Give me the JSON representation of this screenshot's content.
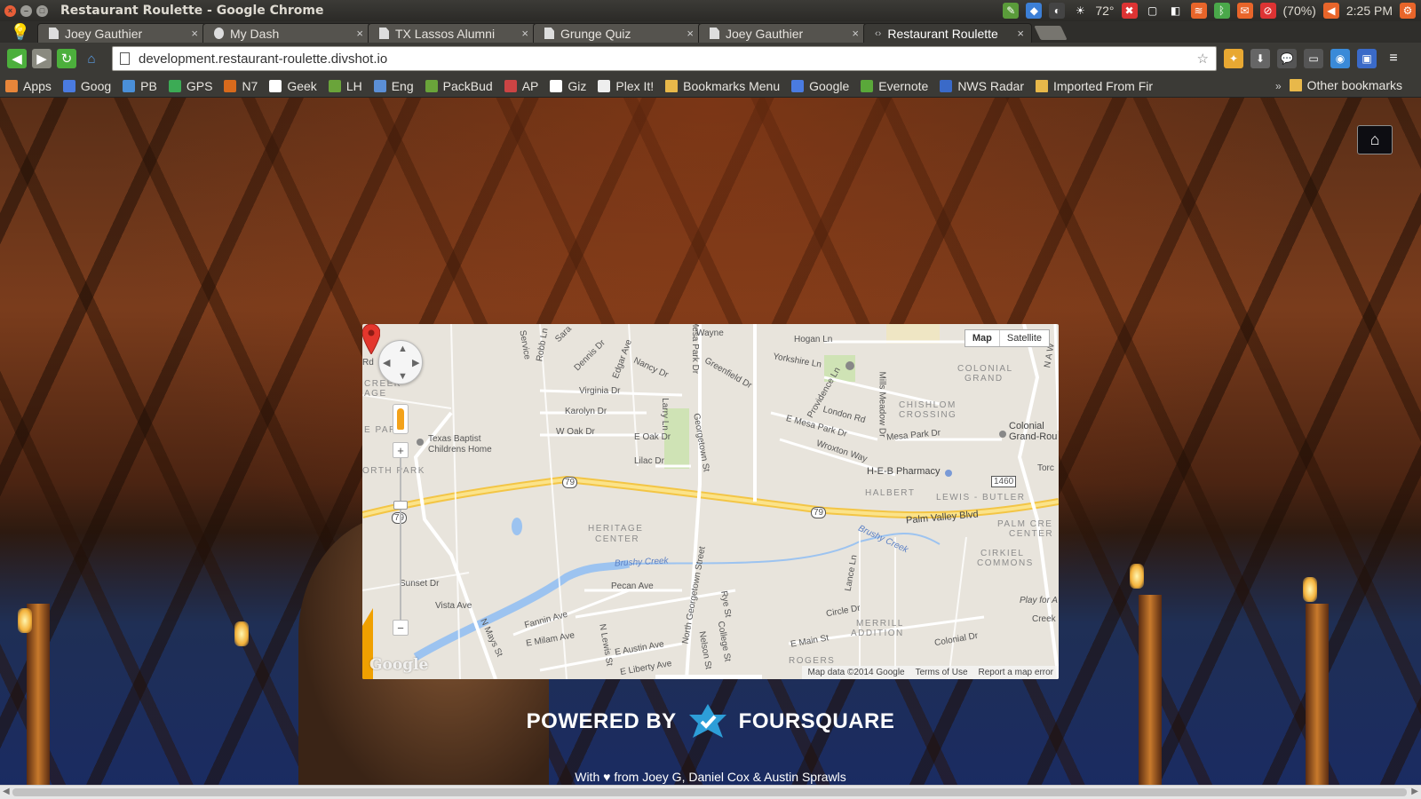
{
  "window": {
    "title": "Restaurant Roulette - Google Chrome"
  },
  "tray": {
    "temperature": "72°",
    "battery": "(70%)",
    "time": "2:25 PM"
  },
  "tabs": [
    {
      "label": "Joey Gauthier",
      "close": "×"
    },
    {
      "label": "My Dash",
      "close": "×"
    },
    {
      "label": "TX Lassos Alumni",
      "close": "×"
    },
    {
      "label": "Grunge Quiz",
      "close": "×"
    },
    {
      "label": "Joey Gauthier",
      "close": "×"
    },
    {
      "label": "Restaurant Roulette",
      "close": "×",
      "active": true
    }
  ],
  "omnibox": {
    "url": "development.restaurant-roulette.divshot.io"
  },
  "bookmarks": [
    {
      "label": "Apps",
      "icon": "apps-grid-icon",
      "color": "#e8863a"
    },
    {
      "label": "Goog",
      "icon": "google-g-icon",
      "color": "#4a7be0"
    },
    {
      "label": "PB",
      "icon": "pushbullet-icon",
      "color": "#4a8fd8"
    },
    {
      "label": "GPS",
      "icon": "play-store-icon",
      "color": "#3cab55"
    },
    {
      "label": "N7",
      "icon": "xda-icon",
      "color": "#d86a1c"
    },
    {
      "label": "Geek",
      "icon": "geek-g-icon",
      "color": "#ffffff"
    },
    {
      "label": "LH",
      "icon": "lifehacker-icon",
      "color": "#6aa43a"
    },
    {
      "label": "Eng",
      "icon": "feed-icon",
      "color": "#5b8fd6"
    },
    {
      "label": "PackBud",
      "icon": "packbud-icon",
      "color": "#6aa43a"
    },
    {
      "label": "AP",
      "icon": "flag-icon",
      "color": "#c44"
    },
    {
      "label": "Giz",
      "icon": "gizmodo-g-icon",
      "color": "#ffffff"
    },
    {
      "label": "Plex It!",
      "icon": "page-icon",
      "color": "#eeeeee"
    },
    {
      "label": "Bookmarks Menu",
      "icon": "folder-icon",
      "color": "#e8b84a"
    },
    {
      "label": "Google",
      "icon": "google-g-icon",
      "color": "#4a7be0"
    },
    {
      "label": "Evernote",
      "icon": "evernote-icon",
      "color": "#5aa83a"
    },
    {
      "label": "NWS Radar",
      "icon": "nws-icon",
      "color": "#3a6ac8"
    },
    {
      "label": "Imported From Fir",
      "icon": "folder-icon",
      "color": "#e8b84a"
    }
  ],
  "other_bookmarks": "Other bookmarks",
  "map": {
    "type_map": "Map",
    "type_satellite": "Satellite",
    "attribution": "Map data ©2014 Google",
    "terms": "Terms of Use",
    "report": "Report a map error",
    "logo": "Google",
    "labels": {
      "texas_baptist": "Texas Baptist",
      "childrens_home": "Childrens Home",
      "heritage": "HERITAGE",
      "center": "CENTER",
      "halbert": "HALBERT",
      "lewis_butler": "LEWIS - BUTLER",
      "colonial_grand_1": "COLONIAL",
      "colonial_grand_2": "GRAND",
      "chislom_1": "CHISHLOM",
      "chislom_2": "CROSSING",
      "palm_creek": "PALM CRE",
      "palm_center": "CENTER",
      "cirkiel_1": "CIRKIEL",
      "cirkiel_2": "COMMONS",
      "merrill_1": "MERRILL",
      "merrill_2": "ADDITION",
      "creek_age": "CREEK",
      "creek_age2": "AGE",
      "e_par": "E PAR",
      "orth_park": "ORTH PARK",
      "rogers": "ROGERS",
      "heb": "H-E-B Pharmacy",
      "colonial_grand_rou": "Colonial",
      "colonial_grand_rou2": "Grand-Rou",
      "palm_valley": "Palm Valley Blvd",
      "brushy1": "Brushy Creek",
      "brushy2": "Brushy Creek",
      "torch": "Torc",
      "play_for": "Play for A",
      "creek": "Creek",
      "hogan": "Hogan Ln",
      "yorkshire": "Yorkshire Ln",
      "providence": "Providence Ln",
      "london": "London Rd",
      "e_mesa": "E Mesa Park Dr",
      "mesa_park": "Mesa Park Dr",
      "wroxton": "Wroxton Way",
      "virginia": "Virginia Dr",
      "karolyn": "Karolyn Dr",
      "w_oak": "W Oak Dr",
      "e_oak": "E Oak Dr",
      "lilac": "Lilac Dr",
      "nancy": "Nancy Dr",
      "greenfield": "Greenfield Dr",
      "dennis": "Dennis Dr",
      "edgar": "Edgar Ave",
      "larry": "Larry Ln",
      "georgetown": "Georgetown St",
      "mesa_park_dr": "Mesa Park Dr",
      "wayne": "Wayne",
      "mills": "Mills Meadow Dr",
      "sunset": "Sunset Dr",
      "vista": "Vista Ave",
      "pecan": "Pecan Ave",
      "fannin": "Fannin Ave",
      "e_milam": "E Milam Ave",
      "e_austin": "E Austin Ave",
      "liberty": "E Liberty Ave",
      "n_georgetown": "North Georgetown Street",
      "nelson": "Nelson St",
      "college": "College St",
      "rye": "Rye St",
      "n_mays": "N Mays St",
      "n_lewis": "N Lewis St",
      "circle": "Circle Dr",
      "e_main": "E Main St",
      "colonial_dr": "Colonial Dr",
      "lance": "Lance Ln",
      "service": "Service",
      "robb": "Robb Ln",
      "sara": "Sara",
      "rd": "Rd",
      "n_aw": "N A W",
      "rt79a": "79",
      "rt79b": "79",
      "rt79c": "79",
      "fm1460": "1460"
    }
  },
  "powered": {
    "left": "POWERED BY",
    "right": "FOURSQUARE"
  },
  "footer": "With ♥ from Joey G, Daniel Cox & Austin Sprawls"
}
